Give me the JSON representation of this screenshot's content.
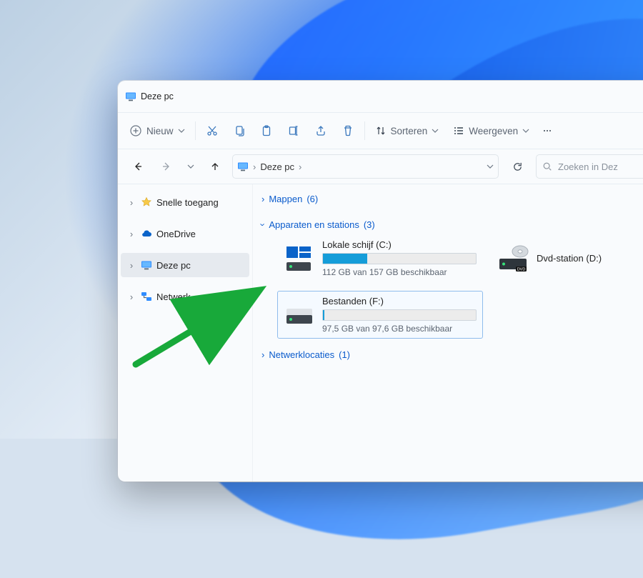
{
  "window": {
    "title": "Deze pc"
  },
  "toolbar": {
    "new": "Nieuw",
    "sort": "Sorteren",
    "view": "Weergeven"
  },
  "nav": {
    "breadcrumb": "Deze pc",
    "search_placeholder": "Zoeken in Dez"
  },
  "sidebar": {
    "quick": "Snelle toegang",
    "onedrive": "OneDrive",
    "thispc": "Deze pc",
    "network": "Netwerk"
  },
  "groups": {
    "mappen": {
      "label": "Mappen",
      "count": "(6)"
    },
    "apparaten": {
      "label": "Apparaten en stations",
      "count": "(3)"
    },
    "netwerk": {
      "label": "Netwerklocaties",
      "count": "(1)"
    }
  },
  "drives": {
    "c": {
      "name": "Lokale schijf (C:)",
      "sub": "112 GB van 157 GB beschikbaar",
      "fill_pct": 29
    },
    "d": {
      "name": "Dvd-station (D:)"
    },
    "f": {
      "name": "Bestanden (F:)",
      "sub": "97,5 GB van 97,6 GB beschikbaar",
      "fill_pct": 1
    }
  }
}
